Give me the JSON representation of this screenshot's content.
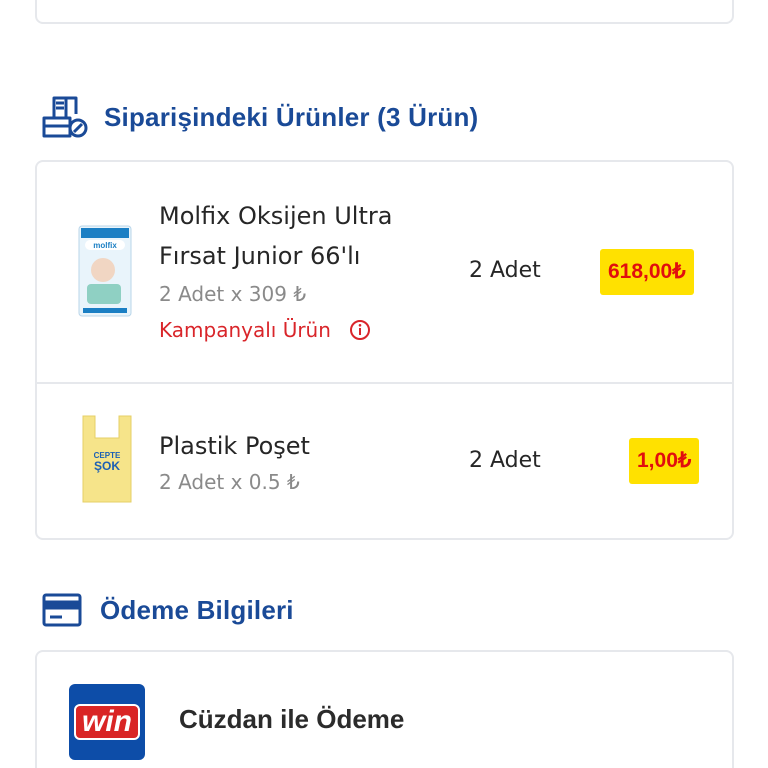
{
  "products_section": {
    "title": "Siparişindeki Ürünler (3 Ürün)",
    "icon": "grocery-bag-icon",
    "items": [
      {
        "name": "Molfix Oksijen Ultra Fırsat Junior 66'lı",
        "unit_line": "2 Adet x 309 ₺",
        "campaign_label": "Kampanyalı Ürün",
        "quantity": "2 Adet",
        "price": "618,00₺",
        "image": "molfix-diaper-pack"
      },
      {
        "name": "Plastik Poşet",
        "unit_line": "2 Adet x 0.5 ₺",
        "quantity": "2 Adet",
        "price": "1,00₺",
        "image": "cepte-sok-plastic-bag"
      }
    ]
  },
  "payment_section": {
    "title": "Ödeme Bilgileri",
    "icon": "credit-card-icon",
    "method_label": "Cüzdan ile Ödeme",
    "method_logo_text": "win"
  },
  "colors": {
    "section_title": "#1a4a97",
    "price_bg": "#ffe100",
    "price_text": "#e10e0e",
    "campaign_text": "#d9252a",
    "border": "#e6e8ec"
  }
}
